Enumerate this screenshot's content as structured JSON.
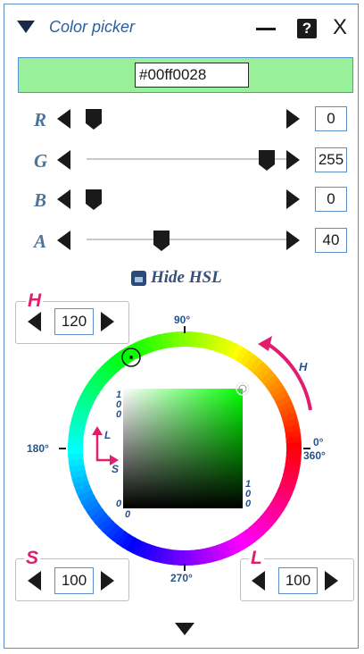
{
  "window": {
    "title": "Color picker",
    "help_label": "?",
    "close_label": "X"
  },
  "preview": {
    "color": "#99f09a",
    "hex_value": "#00ff0028"
  },
  "channels": [
    {
      "label": "R",
      "value": "0",
      "fraction": 0.0
    },
    {
      "label": "G",
      "value": "255",
      "fraction": 1.0
    },
    {
      "label": "B",
      "value": "0",
      "fraction": 0.0
    },
    {
      "label": "A",
      "value": "40",
      "fraction": 0.35
    }
  ],
  "hsl_toggle": {
    "label": "Hide HSL"
  },
  "hsl": {
    "h_label": "H",
    "h_value": "120",
    "s_label": "S",
    "s_value": "100",
    "l_label": "L",
    "l_value": "100"
  },
  "wheel": {
    "deg_90": "90°",
    "deg_180": "180°",
    "deg_0": "0°",
    "deg_360": "360°",
    "deg_270": "270°",
    "arc_label": "H",
    "l_axis_label": "L",
    "s_axis_label": "S",
    "sq_top_left_1": "1",
    "sq_top_left_2": "0",
    "sq_top_left_3": "0",
    "sq_bottom_left": "0",
    "sq_bottom_left_2": "0",
    "sq_bottom_right_1": "1",
    "sq_bottom_right_2": "0",
    "sq_bottom_right_3": "0",
    "hue_color": "#00ff00",
    "accent_color": "#e01e6e"
  },
  "icons": {
    "collapse": "triangle-down-icon",
    "minimize": "minimize-icon",
    "help": "help-icon",
    "close": "close-icon",
    "expand_more": "triangle-down-icon"
  }
}
